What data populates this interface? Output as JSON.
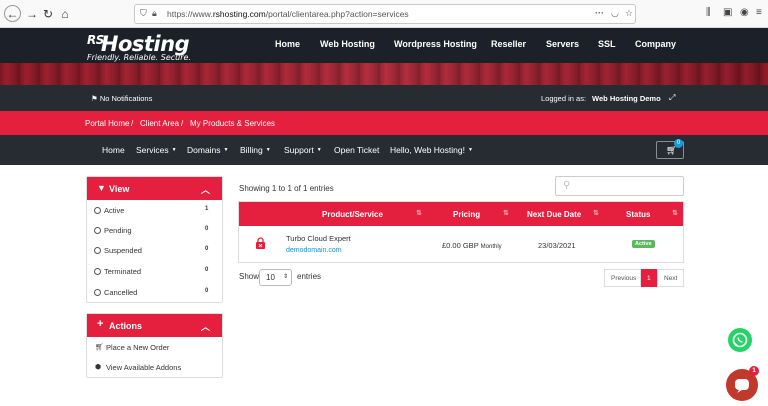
{
  "browser": {
    "url_prefix": "https://www.",
    "url_domain": "rshosting.com",
    "url_path": "/portal/clientarea.php?action=services",
    "more_icon": "···"
  },
  "logo": {
    "rs": "RS",
    "name": "Hosting",
    "tagline": "Friendly. Reliable. Secure."
  },
  "top_nav": [
    "Home",
    "Web Hosting",
    "Wordpress Hosting",
    "Reseller",
    "Servers",
    "SSL",
    "Company"
  ],
  "notification_bar": {
    "notifications": "No Notifications",
    "logged_in_label": "Logged in as:",
    "logged_in_user": "Web Hosting Demo"
  },
  "breadcrumb": [
    "Portal Home",
    "/",
    "Client Area",
    "/",
    "My Products & Services"
  ],
  "sub_nav": [
    "Home",
    "Services",
    "Domains",
    "Billing",
    "Support",
    "Open Ticket",
    "Hello, Web Hosting!"
  ],
  "cart": {
    "count": "0"
  },
  "view_panel": {
    "title": "View",
    "filters": [
      {
        "label": "Active",
        "count": "1"
      },
      {
        "label": "Pending",
        "count": "0"
      },
      {
        "label": "Suspended",
        "count": "0"
      },
      {
        "label": "Terminated",
        "count": "0"
      },
      {
        "label": "Cancelled",
        "count": "0"
      }
    ]
  },
  "actions_panel": {
    "title": "Actions",
    "items": [
      "Place a New Order",
      "View Available Addons"
    ]
  },
  "table": {
    "showing": "Showing 1 to 1 of 1 entries",
    "columns": [
      "Product/Service",
      "Pricing",
      "Next Due Date",
      "Status"
    ],
    "rows": [
      {
        "product": "Turbo Cloud Expert",
        "domain": "demodomain.com",
        "price": "£0.00 GBP",
        "cycle": "Monthly",
        "due": "23/03/2021",
        "status": "Active"
      }
    ]
  },
  "show_entries": {
    "label": "Show",
    "value": "10",
    "suffix": "entries"
  },
  "pagination": {
    "prev": "Previous",
    "current": "1",
    "next": "Next"
  },
  "chat": {
    "badge": "1"
  },
  "colors": {
    "brand_red": "#e5203f",
    "dark": "#272b32",
    "active_green": "#5cb85c",
    "link_blue": "#1a8fd0"
  }
}
